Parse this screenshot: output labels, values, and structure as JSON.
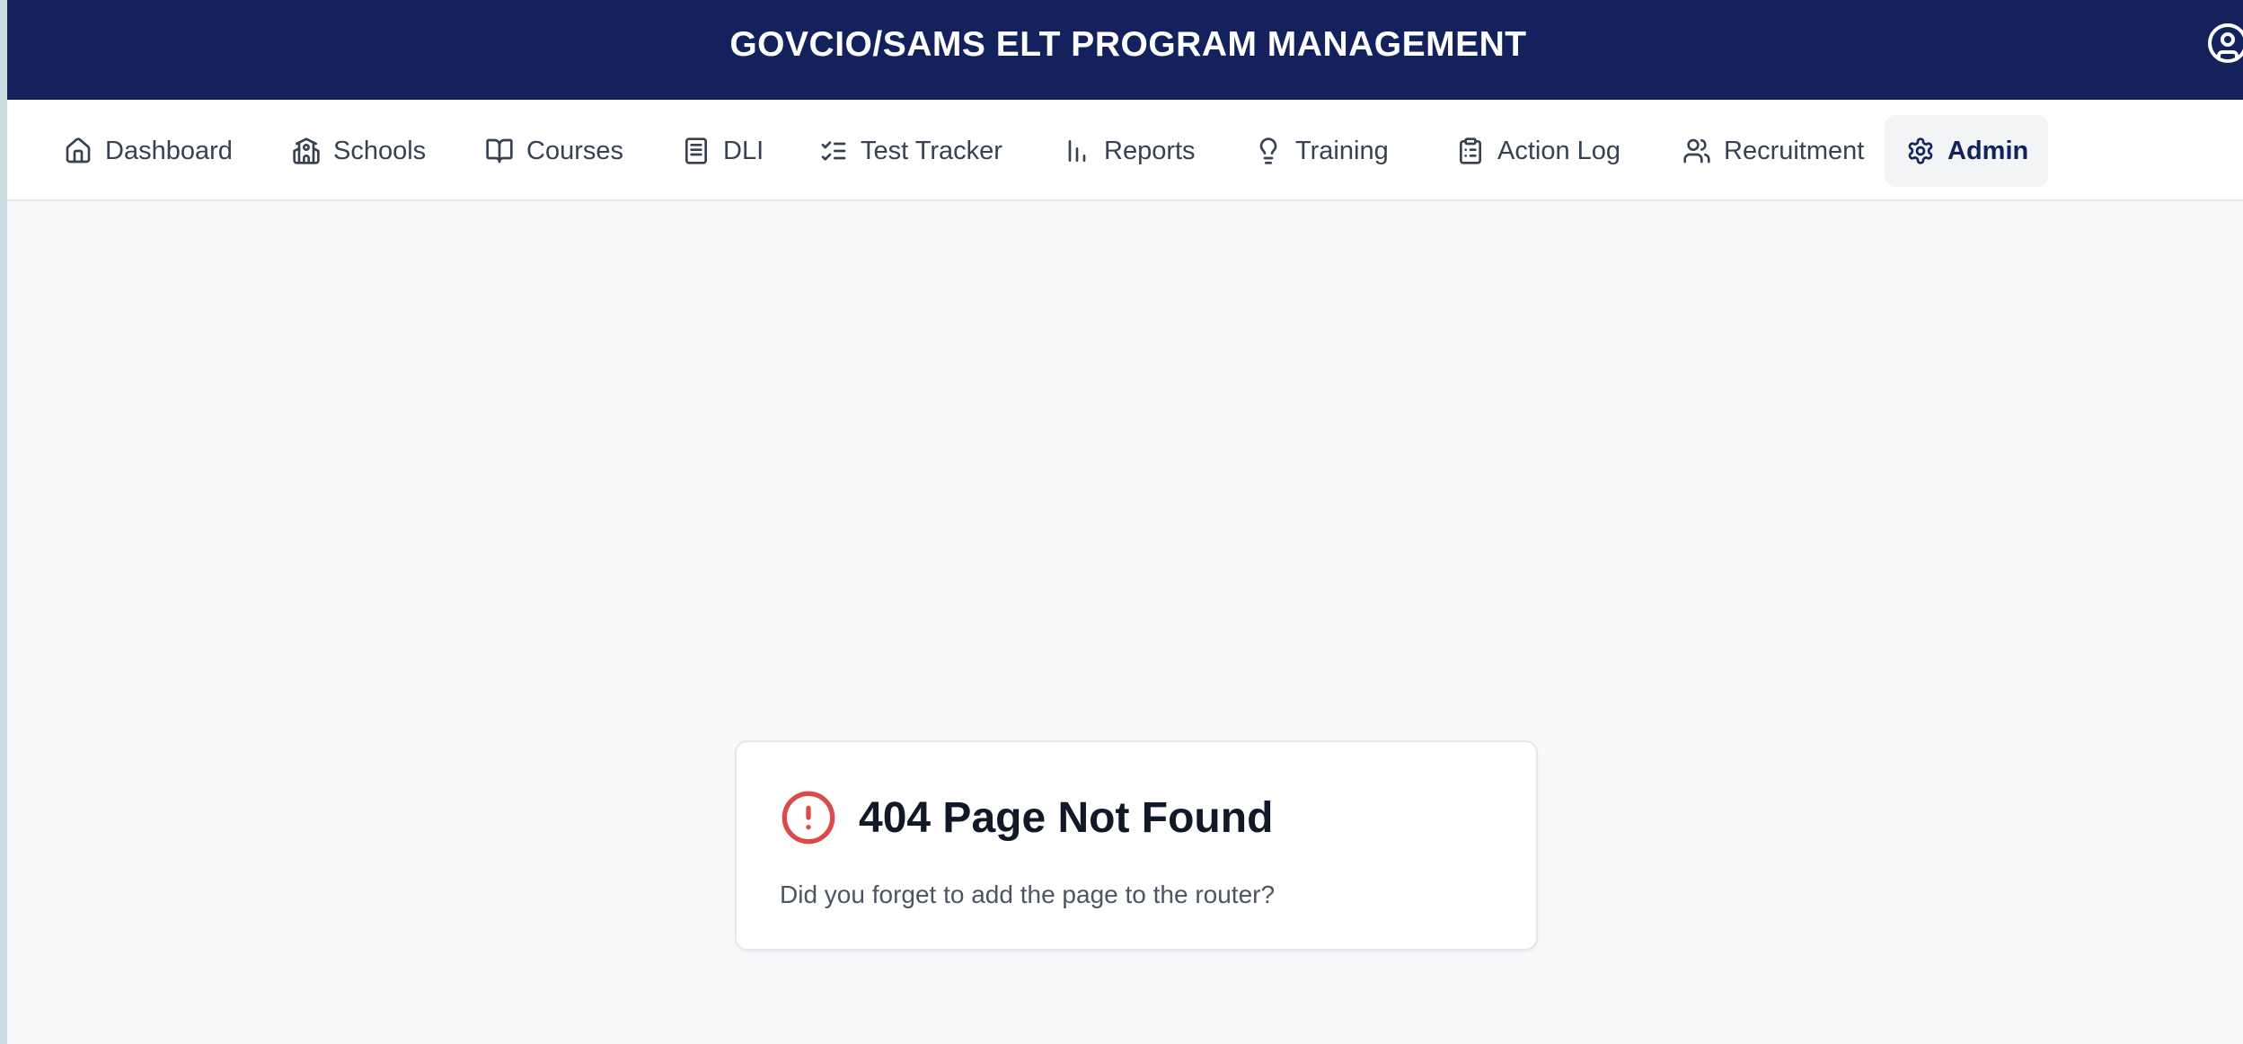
{
  "header": {
    "title": "GOVCIO/SAMS ELT PROGRAM MANAGEMENT",
    "user_icon": "user-circle-icon",
    "background": "#13215c"
  },
  "nav": {
    "items": [
      {
        "label": "Dashboard",
        "icon": "home-icon"
      },
      {
        "label": "Schools",
        "icon": "school-icon"
      },
      {
        "label": "Courses",
        "icon": "book-open-icon"
      },
      {
        "label": "DLI",
        "icon": "book-icon"
      },
      {
        "label": "Test Tracker",
        "icon": "list-checks-icon"
      },
      {
        "label": "Reports",
        "icon": "bar-chart-icon"
      },
      {
        "label": "Training",
        "icon": "lightbulb-icon"
      },
      {
        "label": "Action Log",
        "icon": "clipboard-list-icon"
      },
      {
        "label": "Recruitment",
        "icon": "users-icon"
      },
      {
        "label": "Admin",
        "icon": "gear-icon",
        "active": true
      }
    ],
    "active_color": "#13215c"
  },
  "not_found": {
    "heading": "404 Page Not Found",
    "message": "Did you forget to add the page to the router?",
    "icon": "alert-circle-icon",
    "icon_color": "#dc4b4b"
  }
}
